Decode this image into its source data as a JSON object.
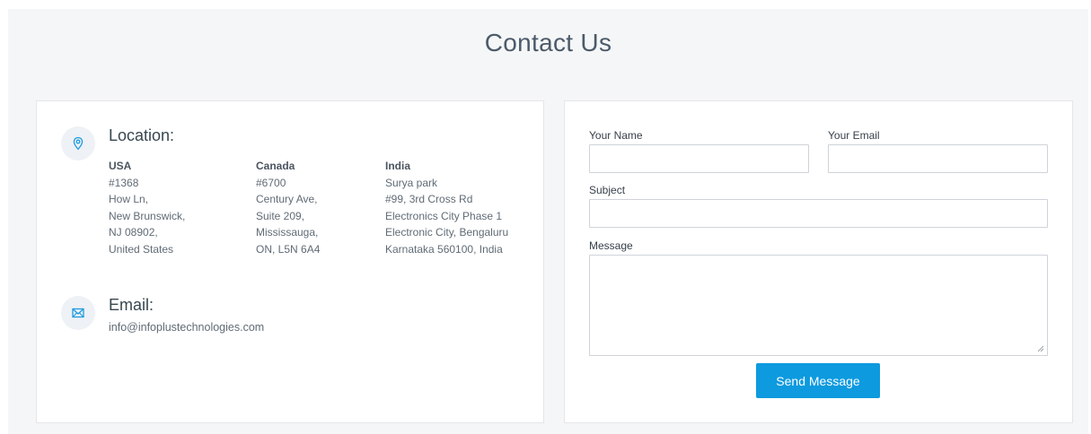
{
  "page_title": "Contact Us",
  "location": {
    "heading": "Location:",
    "offices": [
      {
        "country": "USA",
        "lines": [
          "#1368",
          "How Ln,",
          "New Brunswick,",
          "NJ 08902,",
          "United States"
        ]
      },
      {
        "country": "Canada",
        "lines": [
          "#6700",
          "Century Ave,",
          "Suite 209,",
          "Mississauga,",
          "ON, L5N 6A4"
        ]
      },
      {
        "country": "India",
        "lines": [
          "Surya park",
          "#99, 3rd Cross Rd",
          "Electronics City Phase 1",
          "Electronic City, Bengaluru",
          "Karnataka 560100, India"
        ]
      }
    ]
  },
  "email": {
    "heading": "Email:",
    "address": "info@infoplustechnologies.com"
  },
  "form": {
    "name_label": "Your Name",
    "name_value": "",
    "email_label": "Your Email",
    "email_value": "",
    "subject_label": "Subject",
    "subject_value": "",
    "message_label": "Message",
    "message_value": "",
    "submit_label": "Send Message"
  },
  "colors": {
    "accent": "#0d9adf",
    "icon": "#1e9be0",
    "background": "#f5f6f7"
  },
  "icons": {
    "location": "map-pin-icon",
    "email": "envelope-icon"
  }
}
